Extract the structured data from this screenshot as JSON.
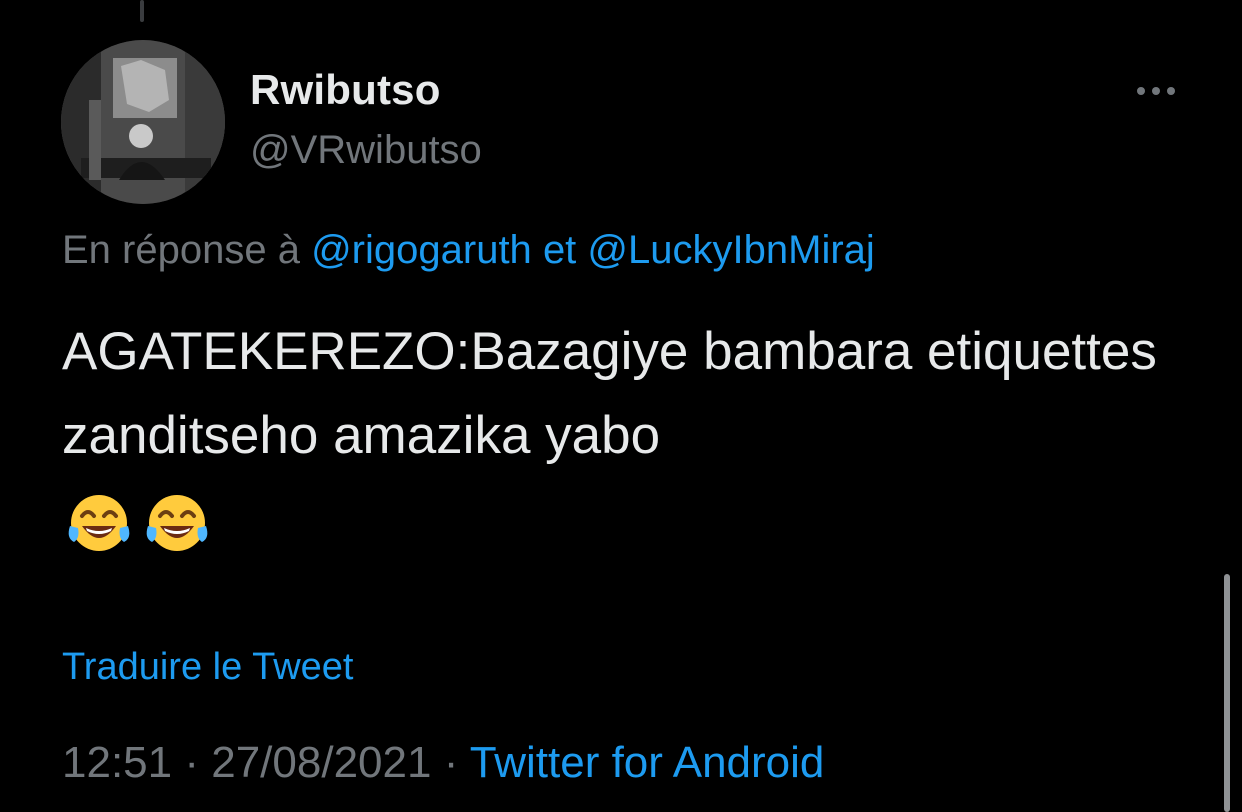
{
  "tweet": {
    "author": {
      "display_name": "Rwibutso",
      "handle": "@VRwibutso",
      "avatar_icon": "profile-photo"
    },
    "more_icon": "more-horizontal-icon",
    "reply_context": {
      "prefix": "En réponse à",
      "mention_1": "@rigogaruth",
      "conjunction": "et",
      "mention_2": "@LuckyIbnMiraj"
    },
    "text": "AGATEKEREZO:Bazagiye bambara etiquettes zanditseho amazika yabo",
    "emojis": [
      "😂",
      "😂"
    ],
    "translate_label": "Traduire le Tweet",
    "time": "12:51",
    "date": "27/08/2021",
    "separator": "·",
    "source": "Twitter for Android"
  },
  "colors": {
    "background": "#000000",
    "primary_text": "#e7e9ea",
    "secondary_text": "#71767b",
    "link": "#1d9bf0"
  }
}
